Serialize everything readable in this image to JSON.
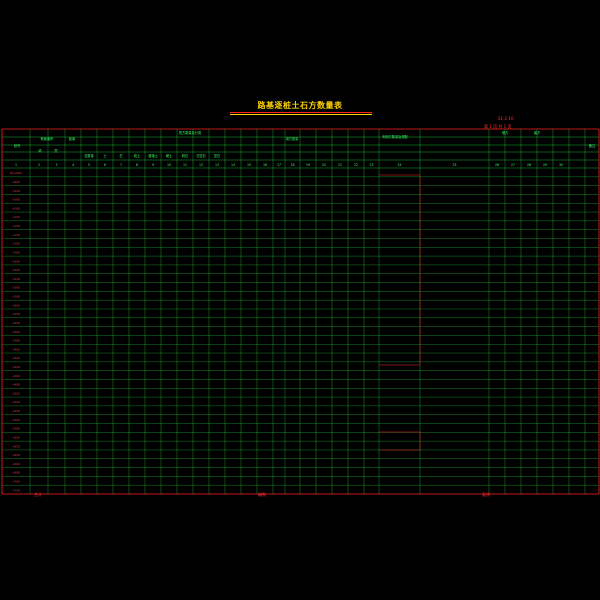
{
  "title": "路基逐桩土石方数量表",
  "sheet_label": "S1-2-10",
  "page_label": "第 1 页 共 1 页",
  "header": {
    "col_station": "桩号",
    "col_area": "断面面积",
    "col_fill": "填",
    "col_cut": "挖",
    "col_dist": "距离",
    "col_cut_volume": "挖方数量及分类",
    "col_fill_volume": "填方数量",
    "col_utilization": "利用方数量及调配",
    "col_borrow": "借方",
    "col_waste": "废方",
    "col_remarks": "备注",
    "sub_cols": [
      "总数量",
      "土",
      "石",
      "松土",
      "普通土",
      "硬土",
      "软石",
      "次坚石",
      "坚石"
    ],
    "index_row": [
      "1",
      "2",
      "3",
      "4",
      "5",
      "6",
      "7",
      "8",
      "9",
      "10",
      "11",
      "12",
      "13",
      "14",
      "15",
      "16",
      "17",
      "18",
      "19",
      "20",
      "21",
      "22",
      "23",
      "24",
      "25",
      "26",
      "27",
      "28",
      "29",
      "30"
    ]
  },
  "stations": [
    "K0+000",
    "+020",
    "+040",
    "+060",
    "+080",
    "+100",
    "+120",
    "+140",
    "+160",
    "+180",
    "+200",
    "+220",
    "+240",
    "+260",
    "+280",
    "+300",
    "+320",
    "+340",
    "+360",
    "+380",
    "+400",
    "+420",
    "+440",
    "+460",
    "+480",
    "+500",
    "+520",
    "+540",
    "+560",
    "+580",
    "+600",
    "+620",
    "+640",
    "+660",
    "+680",
    "+700",
    "+720"
  ],
  "footer": {
    "left": "合计",
    "mid": "编制",
    "right": "复核"
  }
}
